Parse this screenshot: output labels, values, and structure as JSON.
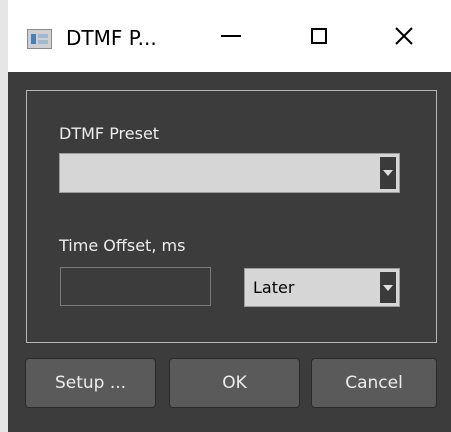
{
  "window": {
    "title": "DTMF P...",
    "minimize_label": "",
    "maximize_label": "",
    "close_label": "×"
  },
  "form": {
    "preset_label": "DTMF Preset",
    "preset_value": "",
    "offset_label": "Time Offset, ms",
    "offset_value": "",
    "direction_value": "Later"
  },
  "buttons": {
    "setup": "Setup ...",
    "ok": "OK",
    "cancel": "Cancel"
  },
  "icons": {
    "app": "app-icon",
    "minimize": "minimize-icon",
    "maximize": "maximize-icon",
    "close": "close-icon",
    "dropdown": "chevron-down-icon"
  }
}
